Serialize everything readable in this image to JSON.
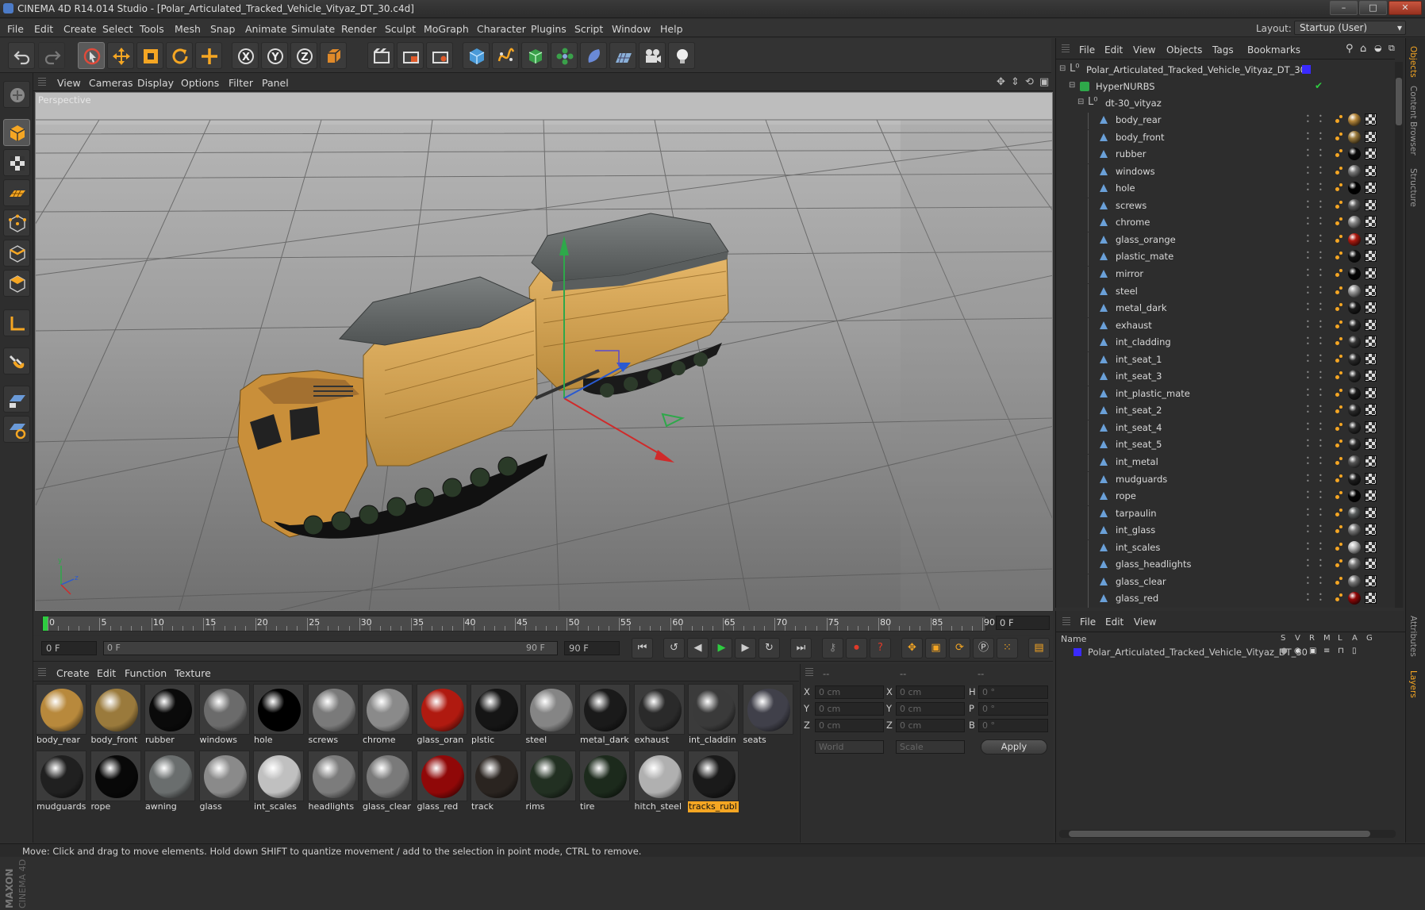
{
  "window": {
    "title": "CINEMA 4D R14.014 Studio - [Polar_Articulated_Tracked_Vehicle_Vityaz_DT_30.c4d]",
    "min": "–",
    "max": "□",
    "close": "✕"
  },
  "menu": [
    "File",
    "Edit",
    "Create",
    "Select",
    "Tools",
    "Mesh",
    "Snap",
    "Animate",
    "Simulate",
    "Render",
    "Sculpt",
    "MoGraph",
    "Character",
    "Plugins",
    "Script",
    "Window",
    "Help"
  ],
  "layout": {
    "label": "Layout:",
    "value": "Startup (User)"
  },
  "toolbar": [
    "undo-icon",
    "redo-icon",
    "live-selection-icon",
    "move-icon",
    "scale-icon",
    "rotate-icon",
    "add-icon",
    "x-axis-icon",
    "y-axis-icon",
    "z-axis-icon",
    "coordinate-system-icon",
    "render-view-icon",
    "render-picture-viewer-icon",
    "edit-render-settings-icon",
    "cube-icon",
    "spline-icon",
    "nurbs-icon",
    "array-icon",
    "deformer-icon",
    "floor-icon",
    "camera-icon",
    "light-icon"
  ],
  "viewport": {
    "menu": [
      "View",
      "Cameras",
      "Display",
      "Options",
      "Filter",
      "Panel"
    ],
    "label": "Perspective"
  },
  "timeline": {
    "ticks": [
      "0",
      "5",
      "10",
      "15",
      "20",
      "25",
      "30",
      "35",
      "40",
      "45",
      "50",
      "55",
      "60",
      "65",
      "70",
      "75",
      "80",
      "85",
      "90"
    ],
    "current": "0 F",
    "start": "0 F",
    "range_start": "0 F",
    "range_end": "90 F",
    "end": "90 F"
  },
  "materials": {
    "menu": [
      "Create",
      "Edit",
      "Function",
      "Texture"
    ],
    "row1": [
      {
        "name": "body_rear",
        "color": "#b8893c"
      },
      {
        "name": "body_front",
        "color": "#9a7a3c"
      },
      {
        "name": "rubber",
        "color": "#0a0a0a"
      },
      {
        "name": "windows",
        "color": "#6b6b6b"
      },
      {
        "name": "hole",
        "color": "#000000"
      },
      {
        "name": "screws",
        "color": "#7a7a7a"
      },
      {
        "name": "chrome",
        "color": "#8a8a8a"
      },
      {
        "name": "glass_oran",
        "color": "#b01a10"
      },
      {
        "name": "plstic",
        "color": "#151515"
      },
      {
        "name": "steel",
        "color": "#858585"
      },
      {
        "name": "metal_dark",
        "color": "#1a1a1a"
      },
      {
        "name": "exhaust",
        "color": "#2a2a2a"
      },
      {
        "name": "int_claddin",
        "color": "#3a3a3a"
      },
      {
        "name": "seats",
        "color": "#40404a"
      }
    ],
    "row2": [
      {
        "name": "mudguards",
        "color": "#202020"
      },
      {
        "name": "rope",
        "color": "#080808"
      },
      {
        "name": "awning",
        "color": "#6a6e6e"
      },
      {
        "name": "glass",
        "color": "#8a8a8a"
      },
      {
        "name": "int_scales",
        "color": "#c0c0c0"
      },
      {
        "name": "headlights",
        "color": "#7c7c7c"
      },
      {
        "name": "glass_clear",
        "color": "#7a7a7a"
      },
      {
        "name": "glass_red",
        "color": "#900808"
      },
      {
        "name": "track",
        "color": "#2a2420"
      },
      {
        "name": "rims",
        "color": "#223022"
      },
      {
        "name": "tire",
        "color": "#1c2a1c"
      },
      {
        "name": "hitch_steel",
        "color": "#b0b0b0"
      },
      {
        "name": "tracks_rubl",
        "color": "#1a1a1a",
        "selected": true
      }
    ]
  },
  "coords": {
    "header": [
      "--",
      "--",
      "--"
    ],
    "x": "0 cm",
    "y": "0 cm",
    "z": "0 cm",
    "h": "0 °",
    "p": "0 °",
    "b": "0 °",
    "mode1": "World",
    "mode2": "Scale",
    "apply": "Apply"
  },
  "objects": {
    "menu": [
      "File",
      "Edit",
      "View",
      "Objects",
      "Tags",
      "Bookmarks"
    ],
    "root": "Polar_Articulated_Tracked_Vehicle_Vityaz_DT_30",
    "hypernurbs": "HyperNURBS",
    "group": "dt-30_vityaz",
    "items": [
      {
        "name": "body_rear",
        "color": "#b8893c"
      },
      {
        "name": "body_front",
        "color": "#9a7a3c"
      },
      {
        "name": "rubber",
        "color": "#0a0a0a"
      },
      {
        "name": "windows",
        "color": "#777777"
      },
      {
        "name": "hole",
        "color": "#000000"
      },
      {
        "name": "screws",
        "color": "#5a5a5a"
      },
      {
        "name": "chrome",
        "color": "#8a8a8a"
      },
      {
        "name": "glass_orange",
        "color": "#b01a10"
      },
      {
        "name": "plastic_mate",
        "color": "#111111"
      },
      {
        "name": "mirror",
        "color": "#050505"
      },
      {
        "name": "steel",
        "color": "#9a9a9a"
      },
      {
        "name": "metal_dark",
        "color": "#1a1a1a"
      },
      {
        "name": "exhaust",
        "color": "#262626"
      },
      {
        "name": "int_cladding",
        "color": "#353535"
      },
      {
        "name": "int_seat_1",
        "color": "#2a2a2a"
      },
      {
        "name": "int_seat_3",
        "color": "#2a2a2a"
      },
      {
        "name": "int_plastic_mate",
        "color": "#1a1a1a"
      },
      {
        "name": "int_seat_2",
        "color": "#2a2a2a"
      },
      {
        "name": "int_seat_4",
        "color": "#2a2a2a"
      },
      {
        "name": "int_seat_5",
        "color": "#2a2a2a"
      },
      {
        "name": "int_metal",
        "color": "#555555"
      },
      {
        "name": "mudguards",
        "color": "#1d1d1d"
      },
      {
        "name": "rope",
        "color": "#050505"
      },
      {
        "name": "tarpaulin",
        "color": "#5a5e5e"
      },
      {
        "name": "int_glass",
        "color": "#777777"
      },
      {
        "name": "int_scales",
        "color": "#bbbbbb"
      },
      {
        "name": "glass_headlights",
        "color": "#777777"
      },
      {
        "name": "glass_clear",
        "color": "#777777"
      },
      {
        "name": "glass_red",
        "color": "#900808"
      }
    ]
  },
  "layers": {
    "menu": [
      "File",
      "Edit",
      "View"
    ],
    "columns": {
      "name": "Name",
      "flags": [
        "S",
        "V",
        "R",
        "M",
        "L",
        "A",
        "G"
      ]
    },
    "row": "Polar_Articulated_Tracked_Vehicle_Vityaz_DT_30"
  },
  "side_tabs": [
    "Objects",
    "Content Browser",
    "Structure",
    "Attributes",
    "Layers"
  ],
  "status": "Move: Click and drag to move elements. Hold down SHIFT to quantize movement / add to the selection in point mode, CTRL to remove.",
  "logo": "MAXON CINEMA 4D"
}
